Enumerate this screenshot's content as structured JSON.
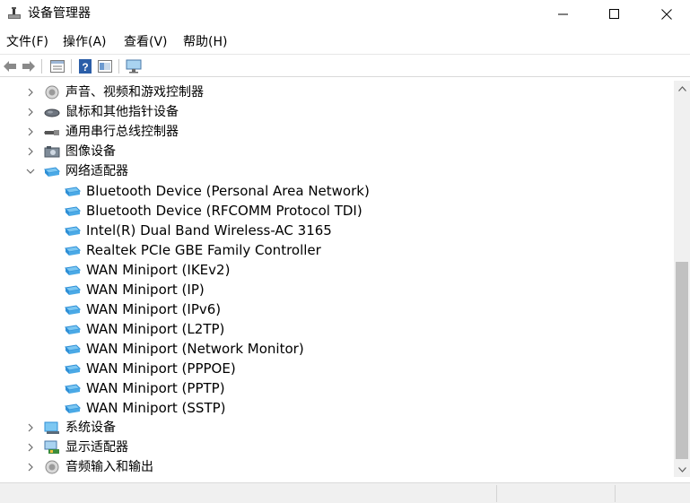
{
  "window": {
    "title": "设备管理器",
    "minimize_icon": "minimize-icon",
    "maximize_icon": "maximize-icon",
    "close_icon": "close-icon"
  },
  "menu": {
    "file": "文件(F)",
    "action": "操作(A)",
    "view": "查看(V)",
    "help": "帮助(H)"
  },
  "toolbar": {
    "icons": [
      "back-arrow-icon",
      "forward-arrow-icon",
      "properties-icon",
      "help-icon",
      "show-hidden-icon",
      "monitor-icon"
    ]
  },
  "tree": {
    "items": [
      {
        "label": "声音、视频和游戏控制器",
        "expanded": false,
        "icon": "speaker-icon"
      },
      {
        "label": "鼠标和其他指针设备",
        "expanded": false,
        "icon": "mouse-icon"
      },
      {
        "label": "通用串行总线控制器",
        "expanded": false,
        "icon": "usb-icon"
      },
      {
        "label": "图像设备",
        "expanded": false,
        "icon": "camera-icon"
      },
      {
        "label": "网络适配器",
        "expanded": true,
        "icon": "network-adapter-icon"
      },
      {
        "label": "Bluetooth Device (Personal Area Network)",
        "icon": "network-adapter-icon"
      },
      {
        "label": "Bluetooth Device (RFCOMM Protocol TDI)",
        "icon": "network-adapter-icon"
      },
      {
        "label": "Intel(R) Dual Band Wireless-AC 3165",
        "icon": "network-adapter-icon"
      },
      {
        "label": "Realtek PCIe GBE Family Controller",
        "icon": "network-adapter-icon"
      },
      {
        "label": "WAN Miniport (IKEv2)",
        "icon": "network-adapter-icon"
      },
      {
        "label": "WAN Miniport (IP)",
        "icon": "network-adapter-icon"
      },
      {
        "label": "WAN Miniport (IPv6)",
        "icon": "network-adapter-icon"
      },
      {
        "label": "WAN Miniport (L2TP)",
        "icon": "network-adapter-icon"
      },
      {
        "label": "WAN Miniport (Network Monitor)",
        "icon": "network-adapter-icon"
      },
      {
        "label": "WAN Miniport (PPPOE)",
        "icon": "network-adapter-icon"
      },
      {
        "label": "WAN Miniport (PPTP)",
        "icon": "network-adapter-icon"
      },
      {
        "label": "WAN Miniport (SSTP)",
        "icon": "network-adapter-icon"
      },
      {
        "label": "系统设备",
        "expanded": false,
        "icon": "system-device-icon"
      },
      {
        "label": "显示适配器",
        "expanded": false,
        "icon": "display-adapter-icon"
      },
      {
        "label": "音频输入和输出",
        "expanded": false,
        "icon": "speaker-icon"
      }
    ]
  },
  "colors": {
    "network_blue": "#2e8fd6",
    "network_light": "#7cc7f2"
  }
}
